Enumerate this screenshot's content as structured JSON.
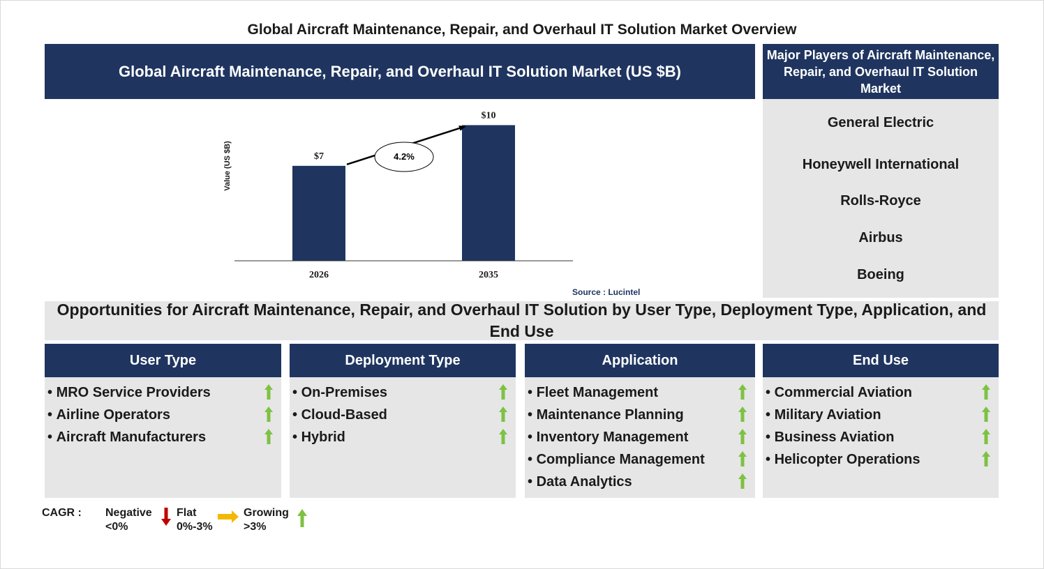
{
  "page_title": "Global Aircraft Maintenance, Repair, and Overhaul IT Solution Market Overview",
  "chart_header": "Global Aircraft Maintenance, Repair, and Overhaul IT Solution Market (US $B)",
  "chart_data": {
    "type": "bar",
    "categories": [
      "2026",
      "2035"
    ],
    "values": [
      7,
      10
    ],
    "value_labels": [
      "$7",
      "$10"
    ],
    "ylabel": "Value (US $B)",
    "ylim": [
      0,
      11
    ],
    "cagr_label": "4.2%",
    "bar_color": "#1f3560",
    "grid": false
  },
  "source": "Source : Lucintel",
  "players": {
    "header": "Major Players of Aircraft Maintenance, Repair, and Overhaul IT Solution Market",
    "items": [
      "General Electric",
      "Honeywell International",
      "Rolls-Royce",
      "Airbus",
      "Boeing"
    ]
  },
  "opportunities_title": "Opportunities for Aircraft Maintenance, Repair, and Overhaul IT Solution by User Type, Deployment Type, Application, and End Use",
  "segments": [
    {
      "title": "User Type",
      "items": [
        "MRO Service Providers",
        "Airline Operators",
        "Aircraft Manufacturers"
      ]
    },
    {
      "title": "Deployment Type",
      "items": [
        "On-Premises",
        "Cloud-Based",
        "Hybrid"
      ]
    },
    {
      "title": "Application",
      "items": [
        "Fleet Management",
        "Maintenance Planning",
        "Inventory Management",
        "Compliance Management",
        "Data Analytics"
      ]
    },
    {
      "title": "End Use",
      "items": [
        "Commercial Aviation",
        "Military Aviation",
        "Business Aviation",
        "Helicopter Operations"
      ]
    }
  ],
  "legend": {
    "label": "CAGR :",
    "negative": "Negative",
    "negative_range": "<0%",
    "flat": "Flat",
    "flat_range": "0%-3%",
    "growing": "Growing",
    "growing_range": ">3%"
  },
  "colors": {
    "navy": "#1f3560",
    "panel_grey": "#e6e6e6",
    "up_arrow": "#7dc242",
    "down_arrow": "#c00000",
    "flat_arrow": "#f5b800"
  }
}
